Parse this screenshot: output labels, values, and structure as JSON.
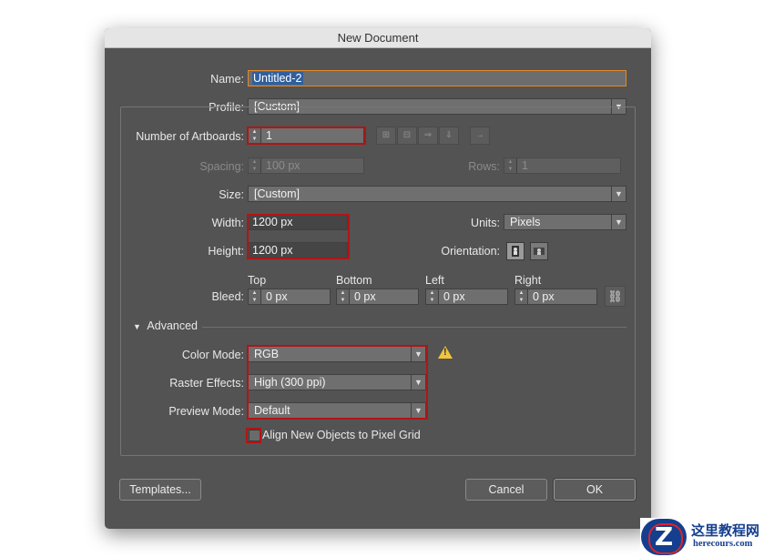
{
  "dialog": {
    "title": "New Document"
  },
  "name": {
    "label": "Name:",
    "value": "Untitled-2"
  },
  "profile": {
    "label": "Profile:",
    "value": "[Custom]"
  },
  "artboards": {
    "label": "Number of Artboards:",
    "value": "1"
  },
  "spacing": {
    "label": "Spacing:",
    "value": "100 px"
  },
  "rows": {
    "label": "Rows:",
    "value": "1"
  },
  "size": {
    "label": "Size:",
    "value": "[Custom]"
  },
  "width": {
    "label": "Width:",
    "value": "1200 px"
  },
  "height": {
    "label": "Height:",
    "value": "1200 px"
  },
  "units": {
    "label": "Units:",
    "value": "Pixels"
  },
  "orientation": {
    "label": "Orientation:",
    "selected": "portrait"
  },
  "bleed": {
    "label": "Bleed:",
    "top": {
      "label": "Top",
      "value": "0 px"
    },
    "bottom": {
      "label": "Bottom",
      "value": "0 px"
    },
    "left": {
      "label": "Left",
      "value": "0 px"
    },
    "right": {
      "label": "Right",
      "value": "0 px"
    }
  },
  "advanced": {
    "label": "Advanced",
    "color_mode": {
      "label": "Color Mode:",
      "value": "RGB"
    },
    "raster_effects": {
      "label": "Raster Effects:",
      "value": "High (300 ppi)"
    },
    "preview_mode": {
      "label": "Preview Mode:",
      "value": "Default"
    },
    "align_pixel_grid": {
      "label": "Align New Objects to Pixel Grid",
      "checked": false
    }
  },
  "buttons": {
    "templates": "Templates...",
    "cancel": "Cancel",
    "ok": "OK"
  },
  "watermark": {
    "logo": "Z",
    "cn": "这里教程网",
    "en": "herecours.com"
  },
  "colors": {
    "highlight": "#b31414",
    "dialog_bg": "#535353",
    "name_focus": "#e08a2b",
    "warning": "#f2c53a"
  }
}
